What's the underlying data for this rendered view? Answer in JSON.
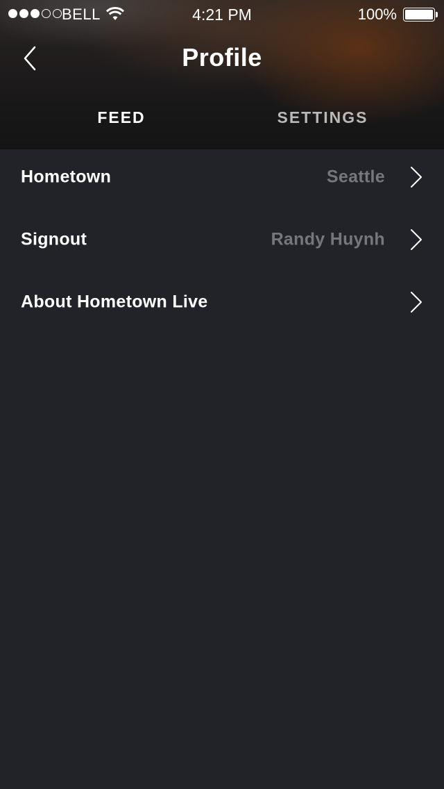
{
  "status_bar": {
    "carrier": "BELL",
    "time": "4:21 PM",
    "battery_percent": "100%",
    "signal_bars_filled": 3,
    "signal_bars_total": 5
  },
  "nav": {
    "title": "Profile",
    "back_icon": "chevron-left-icon"
  },
  "tabs": [
    {
      "label": "FEED",
      "active": true
    },
    {
      "label": "SETTINGS",
      "active": false
    }
  ],
  "list": {
    "items": [
      {
        "label": "Hometown",
        "value": "Seattle"
      },
      {
        "label": "Signout",
        "value": "Randy Huynh"
      },
      {
        "label": "About Hometown Live",
        "value": ""
      }
    ]
  },
  "colors": {
    "background": "#222328",
    "text_primary": "#ffffff",
    "text_secondary": "#76777c",
    "tab_inactive": "#b9b9b9"
  }
}
